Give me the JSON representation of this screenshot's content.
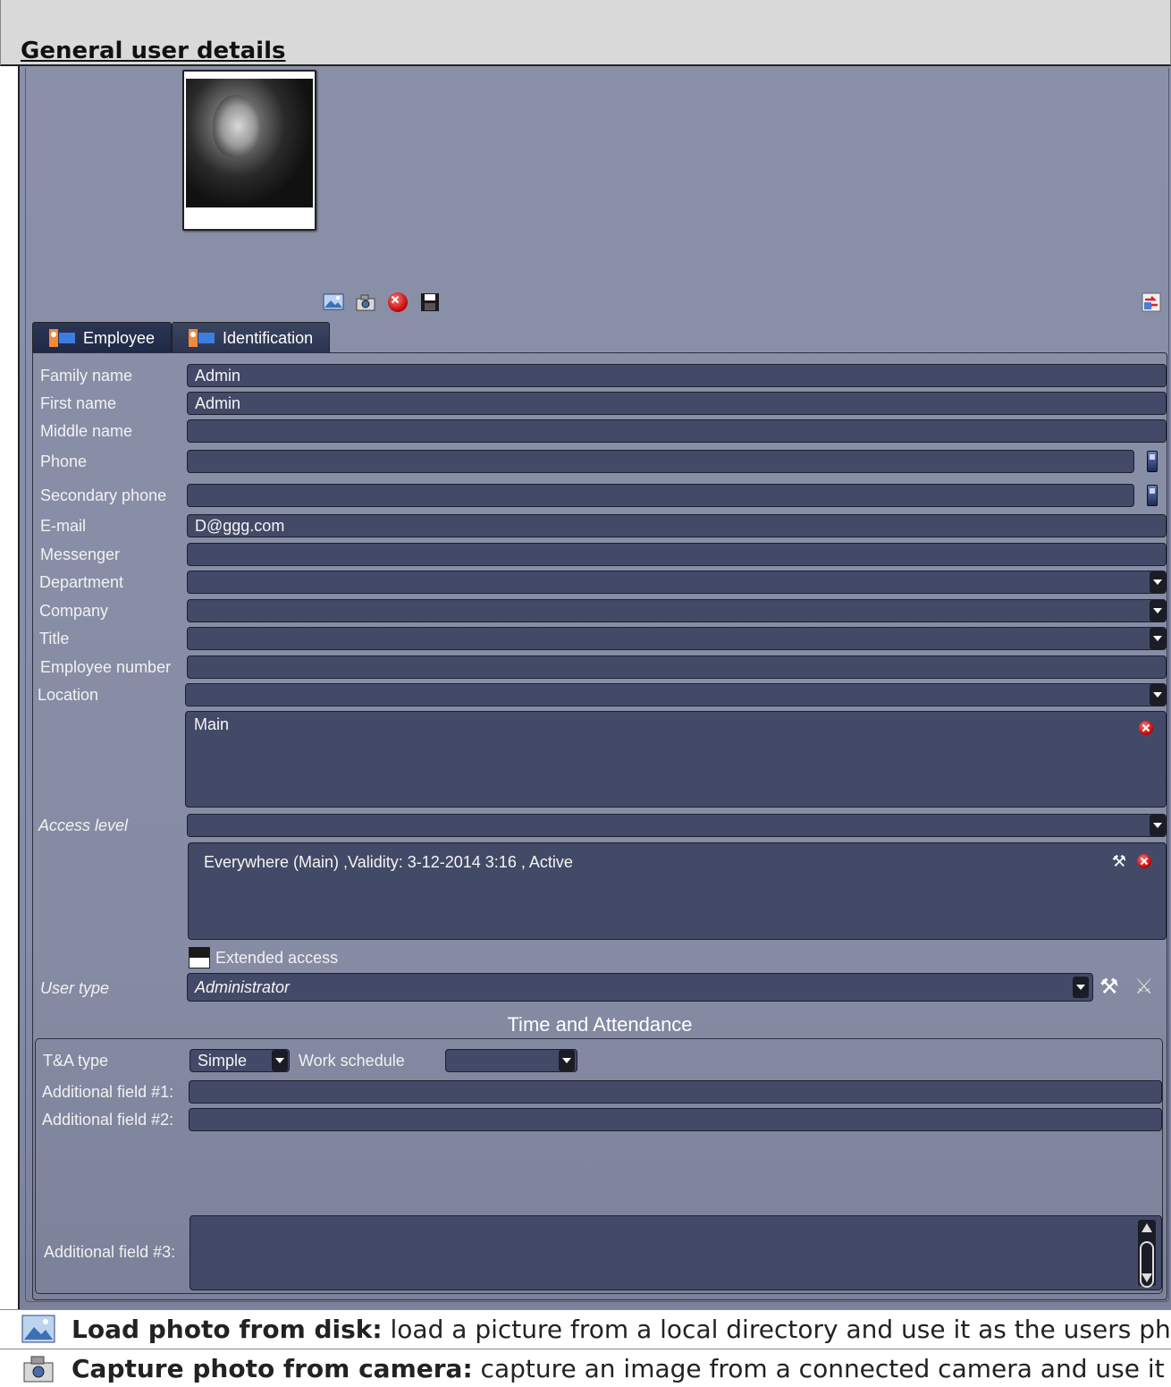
{
  "header": {
    "title": "General user details"
  },
  "toolbar": {
    "load_photo": "image-load-icon",
    "capture_photo": "camera-icon",
    "delete_photo": "delete-icon",
    "save_photo": "save-icon",
    "side": "transfer-icon"
  },
  "tabs": [
    {
      "label": "Employee",
      "active": true
    },
    {
      "label": "Identification",
      "active": false
    }
  ],
  "form": {
    "family_name": {
      "label": "Family name",
      "value": "Admin"
    },
    "first_name": {
      "label": "First name",
      "value": "Admin"
    },
    "middle_name": {
      "label": "Middle name",
      "value": ""
    },
    "phone": {
      "label": "Phone",
      "value": ""
    },
    "secondary_phone": {
      "label": "Secondary phone",
      "value": ""
    },
    "email": {
      "label": "E-mail",
      "value": "D@ggg.com"
    },
    "messenger": {
      "label": "Messenger",
      "value": ""
    },
    "department": {
      "label": "Department",
      "value": ""
    },
    "company": {
      "label": "Company",
      "value": ""
    },
    "title": {
      "label": "Title",
      "value": ""
    },
    "employee_number": {
      "label": "Employee number",
      "value": ""
    },
    "location": {
      "label": "Location",
      "value": "",
      "list": [
        "Main"
      ]
    },
    "access_level": {
      "label": "Access level",
      "value": "",
      "list": [
        "Everywhere (Main) ,Validity: 3-12-2014 3:16 , Active"
      ]
    },
    "extended_access": {
      "label": "Extended access",
      "checked": false
    },
    "user_type": {
      "label": "User type",
      "value": "Administrator"
    }
  },
  "time_attendance": {
    "title": "Time and Attendance",
    "ta_type": {
      "label": "T&A type",
      "value": "Simple"
    },
    "work_schedule": {
      "label": "Work schedule",
      "value": ""
    },
    "additional_1": {
      "label": "Additional field #1:",
      "value": ""
    },
    "additional_2": {
      "label": "Additional field #2:",
      "value": ""
    },
    "additional_3": {
      "label": "Additional field #3:",
      "value": ""
    }
  },
  "doc": [
    {
      "term": "Load photo from disk:",
      "desc": " load a picture from a local directory and use it as the users photo."
    },
    {
      "term": "Capture photo from camera:",
      "desc": " capture an image from a connected camera and use it as users."
    }
  ],
  "colors": {
    "panel_bg": "#868ca4",
    "field_bg": "#434a67",
    "tab_active": "#2c3554",
    "header_bg": "#d9d9d9"
  }
}
